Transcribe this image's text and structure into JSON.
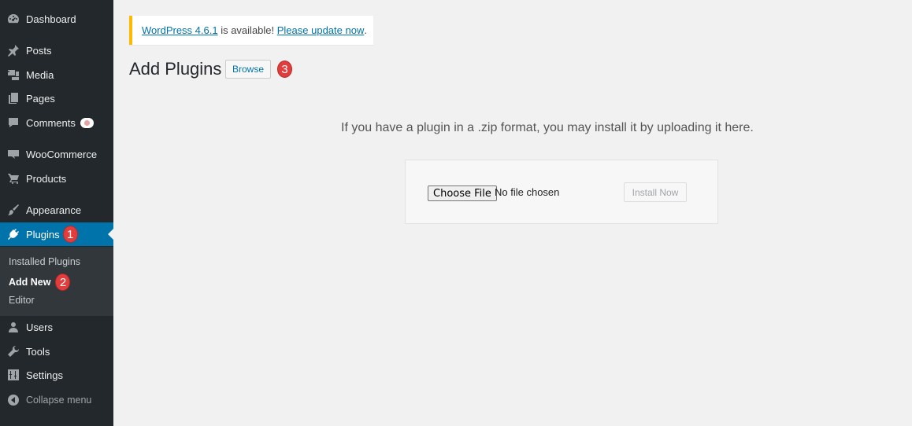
{
  "sidebar": {
    "items": [
      {
        "label": "Dashboard",
        "icon": "dashboard-icon"
      },
      {
        "label": "Posts",
        "icon": "pin-icon"
      },
      {
        "label": "Media",
        "icon": "media-icon"
      },
      {
        "label": "Pages",
        "icon": "pages-icon"
      },
      {
        "label": "Comments",
        "icon": "comment-icon"
      },
      {
        "label": "WooCommerce",
        "icon": "woocommerce-icon"
      },
      {
        "label": "Products",
        "icon": "cart-icon"
      },
      {
        "label": "Appearance",
        "icon": "brush-icon"
      },
      {
        "label": "Plugins",
        "icon": "plugin-icon"
      },
      {
        "label": "Users",
        "icon": "user-icon"
      },
      {
        "label": "Tools",
        "icon": "wrench-icon"
      },
      {
        "label": "Settings",
        "icon": "settings-icon"
      }
    ],
    "submenu": [
      "Installed Plugins",
      "Add New",
      "Editor"
    ],
    "collapse_label": "Collapse menu",
    "active_color": "#0073aa",
    "background_color": "#23282d"
  },
  "markers": [
    "1",
    "2",
    "3"
  ],
  "notice": {
    "link_version": "WordPress 4.6.1",
    "text_middle": " is available! ",
    "link_update": "Please update now",
    "text_end": "."
  },
  "page": {
    "title": "Add Plugins",
    "browse_label": "Browse",
    "upload_description": "If you have a plugin in a .zip format, you may install it by uploading it here.",
    "choose_file_label": "Choose File",
    "file_status": "No file chosen",
    "install_label": "Install Now"
  }
}
